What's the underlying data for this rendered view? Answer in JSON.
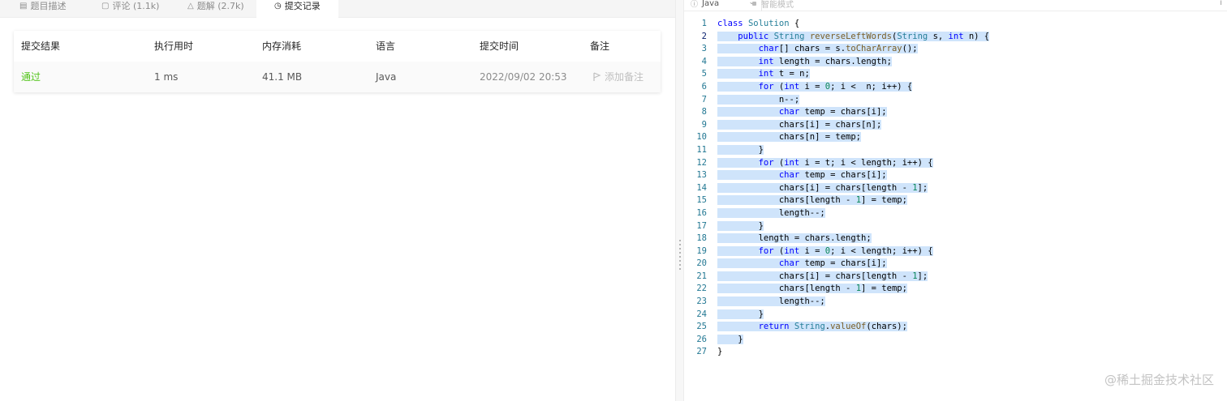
{
  "tabs": [
    {
      "label": "题目描述",
      "icon": "description-icon"
    },
    {
      "label": "评论 (1.1k)",
      "icon": "comment-icon"
    },
    {
      "label": "题解 (2.7k)",
      "icon": "flask-icon"
    },
    {
      "label": "提交记录",
      "icon": "clock-icon",
      "active": true
    }
  ],
  "submissions": {
    "headers": [
      "提交结果",
      "执行用时",
      "内存消耗",
      "语言",
      "提交时间",
      "备注"
    ],
    "row": {
      "result": "通过",
      "runtime": "1 ms",
      "memory": "41.1 MB",
      "language": "Java",
      "time": "2022/09/02 20:53",
      "note": "添加备注"
    }
  },
  "editor": {
    "language": "Java",
    "mode": "智能模式",
    "info_icon": "i",
    "code": [
      "class Solution {",
      "    public String reverseLeftWords(String s, int n) {",
      "        char[] chars = s.toCharArray();",
      "        int length = chars.length;",
      "        int t = n;",
      "        for (int i = 0; i <  n; i++) {",
      "            n--;",
      "            char temp = chars[i];",
      "            chars[i] = chars[n];",
      "            chars[n] = temp;",
      "        }",
      "        for (int i = t; i < length; i++) {",
      "            char temp = chars[i];",
      "            chars[i] = chars[length - 1];",
      "            chars[length - 1] = temp;",
      "            length--;",
      "        }",
      "        length = chars.length;",
      "        for (int i = 0; i < length; i++) {",
      "            char temp = chars[i];",
      "            chars[i] = chars[length - 1];",
      "            chars[length - 1] = temp;",
      "            length--;",
      "        }",
      "        return String.valueOf(chars);",
      "    }",
      "}"
    ]
  },
  "watermark": "@稀土掘金技术社区",
  "colors": {
    "pass": "#52c41a",
    "selection": "#cfe4fb",
    "keyword": "#0000ff",
    "type": "#267f99"
  }
}
